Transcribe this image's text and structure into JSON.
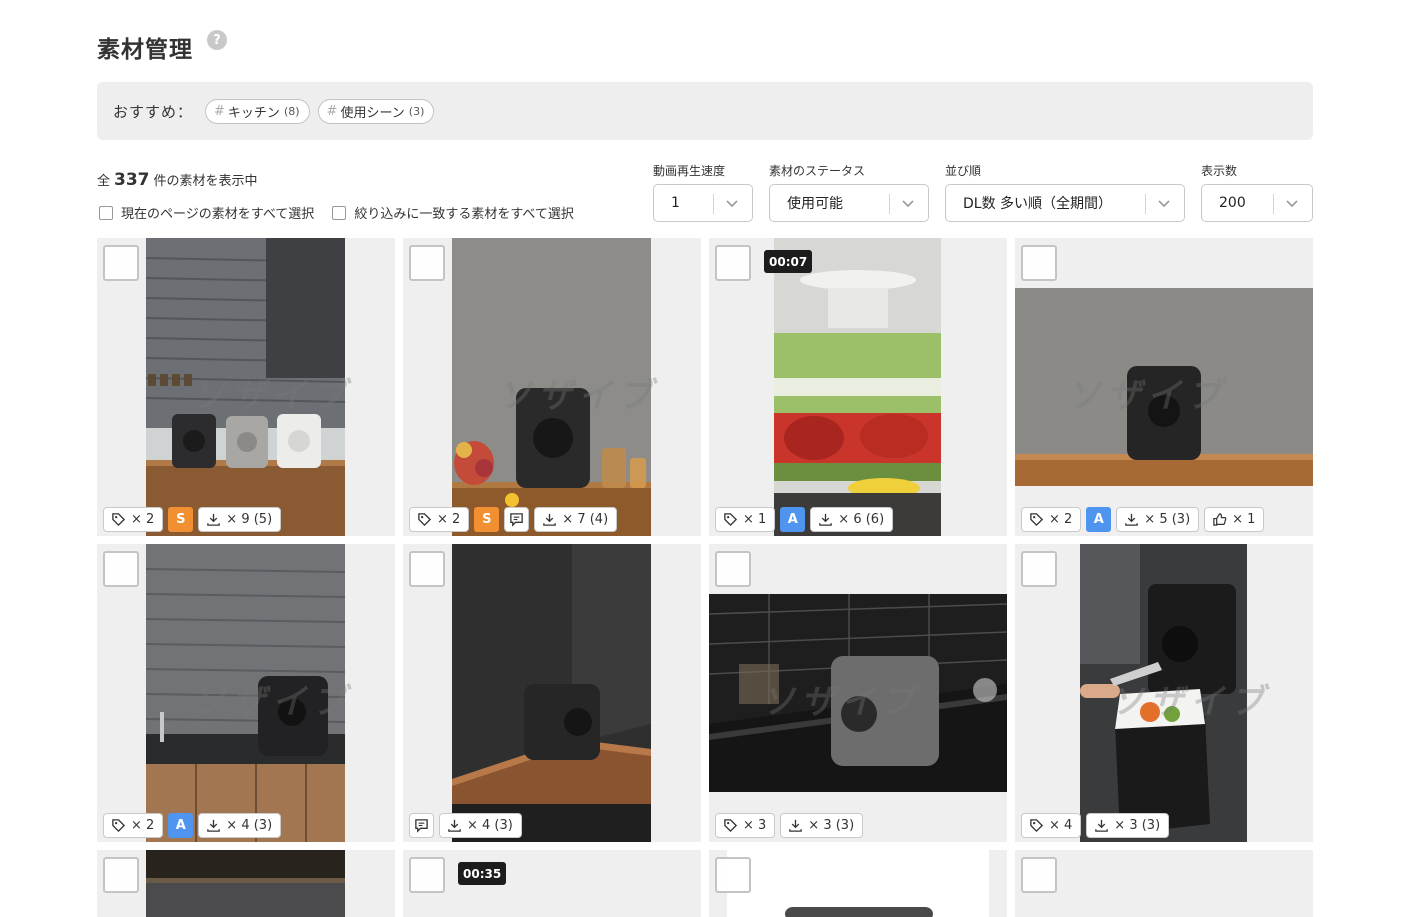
{
  "header": {
    "title": "素材管理",
    "help_glyph": "?"
  },
  "recommend": {
    "label": "おすすめ：",
    "tags": [
      {
        "hash": "#",
        "name": "キッチン",
        "count": "(8)"
      },
      {
        "hash": "#",
        "name": "使用シーン",
        "count": "(3)"
      }
    ]
  },
  "summary": {
    "prefix": "全",
    "count": "337",
    "suffix": "件の素材を表示中"
  },
  "bulk_select": {
    "page_label": "現在のページの素材をすべて選択",
    "filter_label": "絞り込みに一致する素材をすべて選択"
  },
  "filters": {
    "speed": {
      "label": "動画再生速度",
      "value": "1"
    },
    "status": {
      "label": "素材のステータス",
      "value": "使用可能"
    },
    "sort": {
      "label": "並び順",
      "value": "DL数 多い順（全期間）"
    },
    "per_page": {
      "label": "表示数",
      "value": "200"
    }
  },
  "watermark_text": "ソザイブ",
  "cards": [
    {
      "tags": "× 2",
      "grade": "S",
      "comment": false,
      "downloads": "× 9 (5)",
      "likes": null,
      "duration": null
    },
    {
      "tags": "× 2",
      "grade": "S",
      "comment": true,
      "downloads": "× 7 (4)",
      "likes": null,
      "duration": null
    },
    {
      "tags": "× 1",
      "grade": "A",
      "comment": false,
      "downloads": "× 6 (6)",
      "likes": null,
      "duration": "00:07"
    },
    {
      "tags": "× 2",
      "grade": "A",
      "comment": false,
      "downloads": "× 5 (3)",
      "likes": "× 1",
      "duration": null
    },
    {
      "tags": "× 2",
      "grade": "A",
      "comment": false,
      "downloads": "× 4 (3)",
      "likes": null,
      "duration": null
    },
    {
      "tags": null,
      "grade": null,
      "comment": true,
      "downloads": "× 4 (3)",
      "likes": null,
      "duration": null
    },
    {
      "tags": "× 3",
      "grade": null,
      "comment": false,
      "downloads": "× 3 (3)",
      "likes": null,
      "duration": null
    },
    {
      "tags": "× 4",
      "grade": null,
      "comment": false,
      "downloads": "× 3 (3)",
      "likes": null,
      "duration": null
    },
    {
      "duration": null
    },
    {
      "duration": "00:35"
    },
    {
      "duration": null
    },
    {
      "duration": null
    }
  ],
  "colors": {
    "grade_s": "#f18f33",
    "grade_a": "#4f95ef",
    "panel_bg": "#eeeeee",
    "card_bg": "#efefef"
  }
}
